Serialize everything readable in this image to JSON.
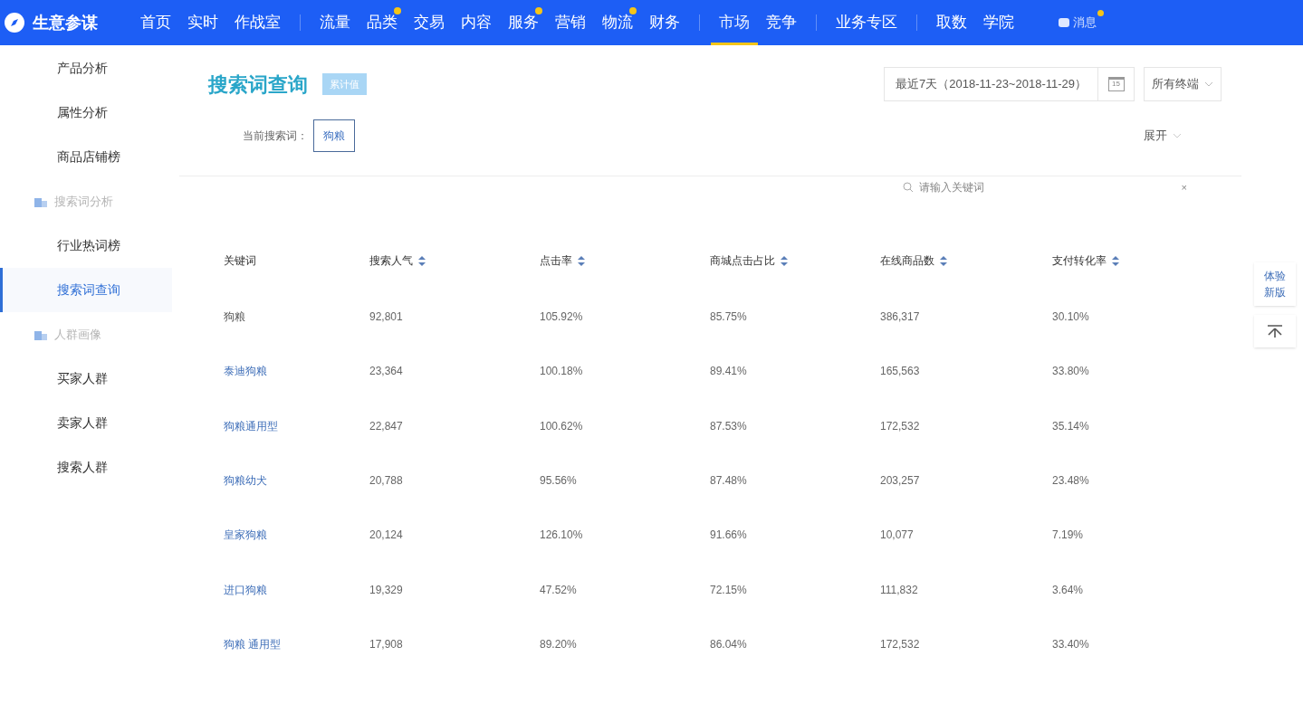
{
  "brand": "生意参谋",
  "nav_groups": [
    [
      {
        "label": "首页",
        "dot": false,
        "selected": false
      },
      {
        "label": "实时",
        "dot": false,
        "selected": false
      },
      {
        "label": "作战室",
        "dot": false,
        "selected": false
      }
    ],
    [
      {
        "label": "流量",
        "dot": false,
        "selected": false
      },
      {
        "label": "品类",
        "dot": true,
        "selected": false
      },
      {
        "label": "交易",
        "dot": false,
        "selected": false
      },
      {
        "label": "内容",
        "dot": false,
        "selected": false
      },
      {
        "label": "服务",
        "dot": true,
        "selected": false
      },
      {
        "label": "营销",
        "dot": false,
        "selected": false
      },
      {
        "label": "物流",
        "dot": true,
        "selected": false
      },
      {
        "label": "财务",
        "dot": false,
        "selected": false
      }
    ],
    [
      {
        "label": "市场",
        "dot": false,
        "selected": true
      },
      {
        "label": "竞争",
        "dot": false,
        "selected": false
      }
    ],
    [
      {
        "label": "业务专区",
        "dot": false,
        "selected": false
      }
    ],
    [
      {
        "label": "取数",
        "dot": false,
        "selected": false
      },
      {
        "label": "学院",
        "dot": false,
        "selected": false
      }
    ]
  ],
  "messages": {
    "label": "消息",
    "dot": true
  },
  "sidebar": {
    "items": [
      {
        "kind": "link",
        "label": "产品分析",
        "selected": false
      },
      {
        "kind": "link",
        "label": "属性分析",
        "selected": false
      },
      {
        "kind": "link",
        "label": "商品店铺榜",
        "selected": false
      },
      {
        "kind": "section",
        "label": "搜索词分析"
      },
      {
        "kind": "link",
        "label": "行业热词榜",
        "selected": false
      },
      {
        "kind": "link",
        "label": "搜索词查询",
        "selected": true
      },
      {
        "kind": "section",
        "label": "人群画像"
      },
      {
        "kind": "link",
        "label": "买家人群",
        "selected": false
      },
      {
        "kind": "link",
        "label": "卖家人群",
        "selected": false
      },
      {
        "kind": "link",
        "label": "搜索人群",
        "selected": false
      }
    ]
  },
  "page_title": "搜索词查询",
  "title_badge": "累计值",
  "date_range": "最近7天（2018-11-23~2018-11-29）",
  "calendar_day": "15",
  "terminal_select": "所有终端",
  "current_term": {
    "label": "当前搜索词：",
    "value": "狗粮"
  },
  "expand": "展开",
  "search": {
    "placeholder": "请输入关键词",
    "clear": "×"
  },
  "table": {
    "columns": [
      {
        "label": "关键词",
        "sortable": false
      },
      {
        "label": "搜索人气",
        "sortable": true
      },
      {
        "label": "点击率",
        "sortable": true
      },
      {
        "label": "商城点击占比",
        "sortable": true
      },
      {
        "label": "在线商品数",
        "sortable": true
      },
      {
        "label": "支付转化率",
        "sortable": true
      }
    ],
    "rows": [
      {
        "link": false,
        "cells": [
          "狗粮",
          "92,801",
          "105.92%",
          "85.75%",
          "386,317",
          "30.10%"
        ]
      },
      {
        "link": true,
        "cells": [
          "泰迪狗粮",
          "23,364",
          "100.18%",
          "89.41%",
          "165,563",
          "33.80%"
        ]
      },
      {
        "link": true,
        "cells": [
          "狗粮通用型",
          "22,847",
          "100.62%",
          "87.53%",
          "172,532",
          "35.14%"
        ]
      },
      {
        "link": true,
        "cells": [
          "狗粮幼犬",
          "20,788",
          "95.56%",
          "87.48%",
          "203,257",
          "23.48%"
        ]
      },
      {
        "link": true,
        "cells": [
          "皇家狗粮",
          "20,124",
          "126.10%",
          "91.66%",
          "10,077",
          "7.19%"
        ]
      },
      {
        "link": true,
        "cells": [
          "进口狗粮",
          "19,329",
          "47.52%",
          "72.15%",
          "111,832",
          "3.64%"
        ]
      },
      {
        "link": true,
        "cells": [
          "狗粮 通用型",
          "17,908",
          "89.20%",
          "86.04%",
          "172,532",
          "33.40%"
        ]
      }
    ]
  },
  "side_tools": {
    "try_new": "体验新版"
  }
}
